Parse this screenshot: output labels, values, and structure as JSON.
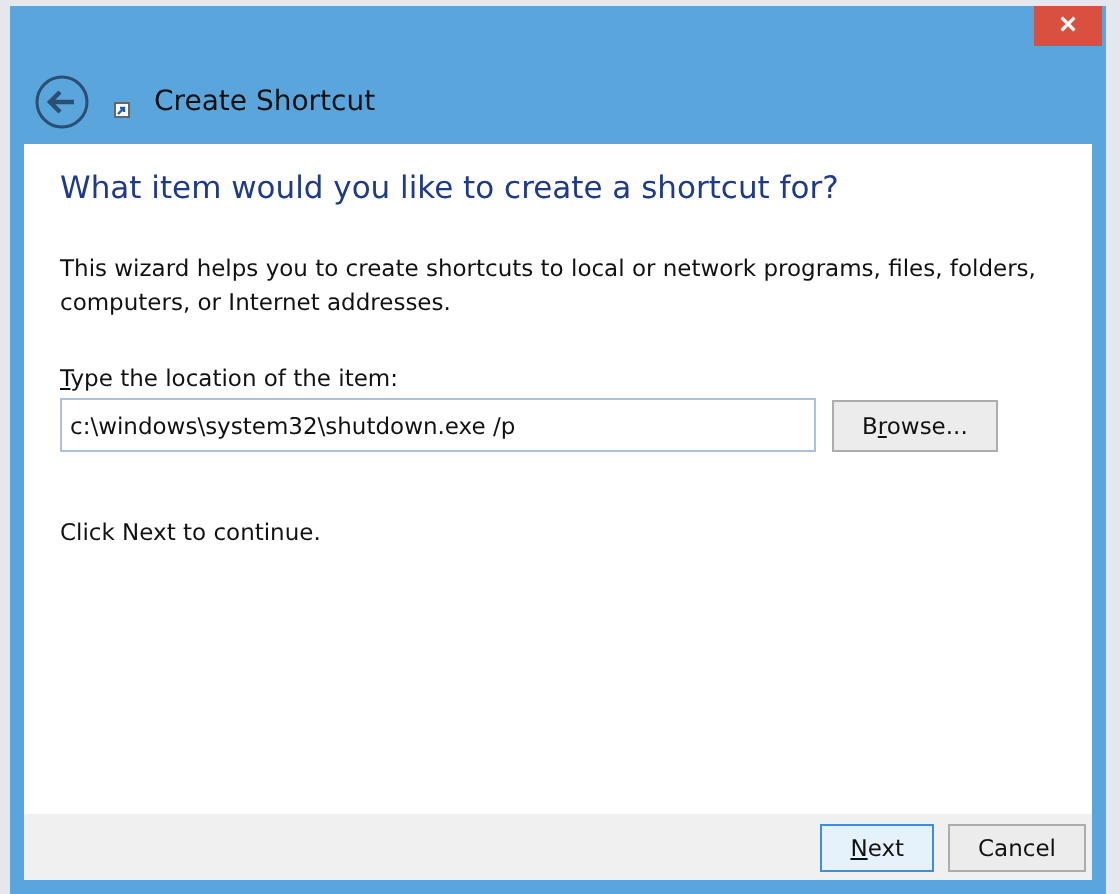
{
  "window": {
    "title": "Create Shortcut",
    "close": "×"
  },
  "heading": "What item would you like to create a shortcut for?",
  "description": "This wizard helps you to create shortcuts to local or network programs, files, folders, computers, or Internet addresses.",
  "location": {
    "label": {
      "accel": "T",
      "rest": "ype the location of the item:"
    },
    "value": "c:\\windows\\system32\\shutdown.exe /p"
  },
  "browse_button": {
    "before": "B",
    "accel": "r",
    "rest": "owse..."
  },
  "hint": "Click Next to continue.",
  "buttons": [
    {
      "accel": "N",
      "rest": "ext",
      "selected": true
    },
    {
      "rest": "Cancel",
      "selected": false
    }
  ]
}
